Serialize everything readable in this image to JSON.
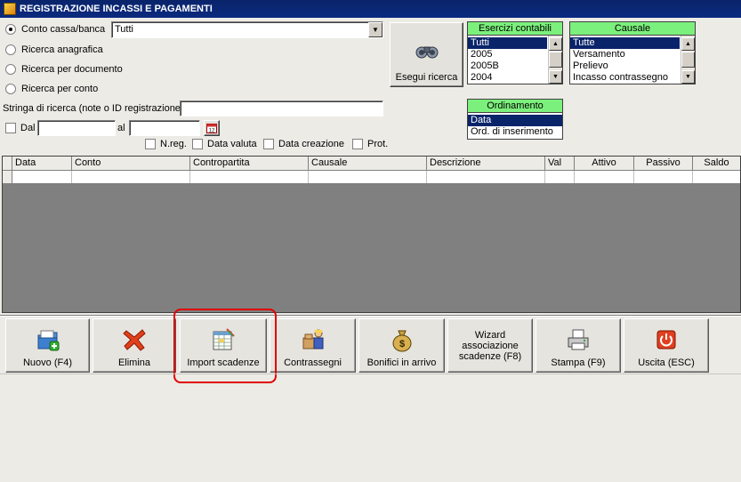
{
  "window": {
    "title": "REGISTRAZIONE INCASSI E PAGAMENTI"
  },
  "search": {
    "radio_options": [
      {
        "label": "Conto cassa/banca",
        "checked": true
      },
      {
        "label": "Ricerca anagrafica",
        "checked": false
      },
      {
        "label": "Ricerca per documento",
        "checked": false
      },
      {
        "label": "Ricerca per conto",
        "checked": false
      }
    ],
    "conto_value": "Tutti",
    "search_string_label": "Stringa di ricerca (note o ID registrazione)",
    "search_string_value": "",
    "dal_label": "Dal",
    "al_label": "al",
    "dal_value": "",
    "al_value": "",
    "checks": [
      "N.reg.",
      "Data valuta",
      "Data creazione",
      "Prot."
    ],
    "run_button": "Esegui ricerca"
  },
  "esercizi": {
    "title": "Esercizi contabili",
    "items": [
      "Tutti",
      "2005",
      "2005B",
      "2004"
    ],
    "selected": "Tutti"
  },
  "causale": {
    "title": "Causale",
    "items": [
      "Tutte",
      "Versamento",
      "Prelievo",
      "Incasso contrassegno"
    ],
    "selected": "Tutte"
  },
  "ordinamento": {
    "title": "Ordinamento",
    "items": [
      "Data",
      "Ord. di inserimento"
    ],
    "selected": "Data"
  },
  "grid": {
    "columns": [
      "Data",
      "Conto",
      "Contropartita",
      "Causale",
      "Descrizione",
      "Val",
      "Attivo",
      "Passivo",
      "Saldo"
    ]
  },
  "toolbar": {
    "nuovo": "Nuovo (F4)",
    "elimina": "Elimina",
    "import": "Import scadenze",
    "contrassegni": "Contrassegni",
    "bonifici": "Bonifici in arrivo",
    "wizard": "Wizard associazione scadenze (F8)",
    "stampa": "Stampa (F9)",
    "uscita": "Uscita (ESC)"
  },
  "colors": {
    "titlebar": "#0a246a",
    "panel_header": "#7cf07c",
    "selection": "#0a246a",
    "highlight_outline": "#e00000",
    "grid_empty": "#808080"
  }
}
